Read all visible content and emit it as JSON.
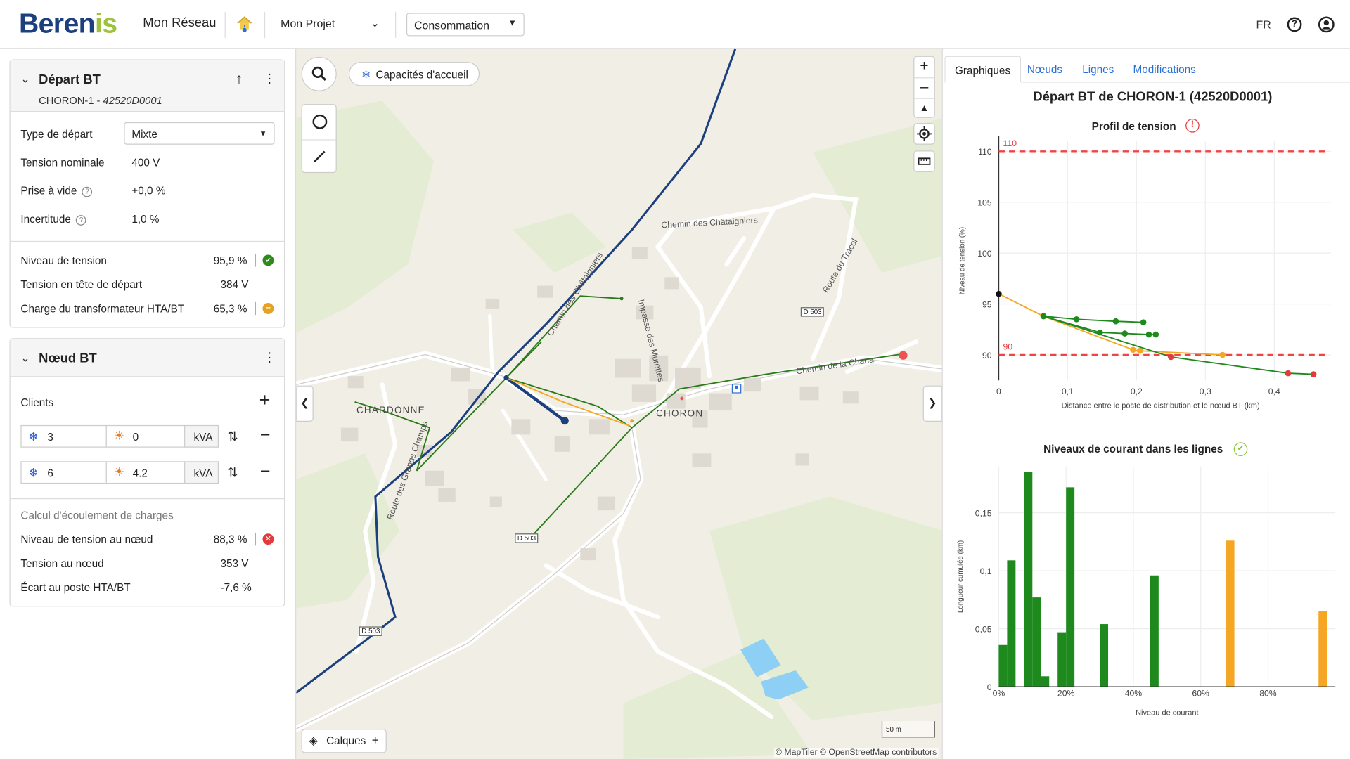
{
  "header": {
    "logo_main": "Beren",
    "logo_accent": "is",
    "app_title": "Mon Réseau",
    "project": "Mon Projet",
    "mode": "Consommation",
    "lang": "FR"
  },
  "depart": {
    "title": "Départ BT",
    "subtitle_name": "CHORON-1 - ",
    "subtitle_code": "42520D0001",
    "fields": [
      {
        "label": "Type de départ",
        "value": "Mixte"
      },
      {
        "label": "Tension nominale",
        "value": "400 V"
      },
      {
        "label": "Prise à vide",
        "value": "+0,0 %"
      },
      {
        "label": "Incertitude",
        "value": "1,0 %"
      }
    ],
    "results": [
      {
        "label": "Niveau de tension",
        "value": "95,9 %",
        "status": "ok"
      },
      {
        "label": "Tension en tête de départ",
        "value": "384 V"
      },
      {
        "label": "Charge du transformateur HTA/BT",
        "value": "65,3 %",
        "status": "warning"
      }
    ]
  },
  "noeud": {
    "title": "Nœud BT",
    "clients_label": "Clients",
    "clients": [
      {
        "cold": "3",
        "sun": "0",
        "unit": "kVA"
      },
      {
        "cold": "6",
        "sun": "4.2",
        "unit": "kVA"
      }
    ],
    "calc_label": "Calcul d'écoulement de charges",
    "results": [
      {
        "label": "Niveau de tension au nœud",
        "value": "88,3 %",
        "status": "error"
      },
      {
        "label": "Tension au nœud",
        "value": "353 V"
      },
      {
        "label": "Écart au poste HTA/BT",
        "value": "-7,6 %"
      }
    ]
  },
  "map": {
    "capacites": "Capacités d'accueil",
    "calques": "Calques",
    "attribution": "© MapTiler © OpenStreetMap contributors",
    "scale": "50 m",
    "labels": [
      "Chemin des Châtaigniers",
      "Impasse des Murettes",
      "Route du Tracol",
      "Chemin de la Chana",
      "Chemin des Châtaigniers",
      "Route des Grands Champs"
    ],
    "places": [
      "CHARDONNE",
      "CHORON"
    ],
    "roads": [
      "D 503",
      "D 503",
      "D 503"
    ]
  },
  "right": {
    "tabs": [
      "Graphiques",
      "Nœuds",
      "Lignes",
      "Modifications"
    ],
    "active_tab": "Graphiques",
    "title": "Départ BT de CHORON-1 (42520D0001)"
  },
  "colors": {
    "accent": "#2a6fd6",
    "brand_blue": "#1c3f7e",
    "brand_green": "#9cc33a",
    "ok": "#2f8a1c",
    "warn": "#e6a323",
    "err": "#e23b3b"
  },
  "chart_data": [
    {
      "type": "line",
      "title": "Profil de tension",
      "xlabel": "Distance entre le poste de distribution et le nœud BT (km)",
      "ylabel": "Niveau de tension (%)",
      "xlim": [
        0,
        0.47
      ],
      "ylim": [
        87.5,
        111
      ],
      "xticks": [
        "0",
        "0,1",
        "0,2",
        "0,3",
        "0,4"
      ],
      "yticks": [
        "90",
        "95",
        "100",
        "105",
        "110"
      ],
      "limits": [
        {
          "value": 110,
          "label": "110"
        },
        {
          "value": 90,
          "label": "90"
        }
      ],
      "series": [
        {
          "color": "#f5a623",
          "points": [
            [
              0,
              96
            ],
            [
              0.065,
              93.8
            ],
            [
              0.195,
              90.5
            ],
            [
              0.205,
              90.4
            ],
            [
              0.325,
              90
            ]
          ]
        },
        {
          "color": "#1e8a1e",
          "points": [
            [
              0.065,
              93.8
            ],
            [
              0.113,
              93.5
            ],
            [
              0.17,
              93.3
            ],
            [
              0.21,
              93.2
            ]
          ]
        },
        {
          "color": "#1e8a1e",
          "points": [
            [
              0.065,
              93.8
            ],
            [
              0.147,
              92.2
            ],
            [
              0.183,
              92.1
            ],
            [
              0.218,
              92
            ],
            [
              0.228,
              92
            ]
          ]
        },
        {
          "color": "#1e8a1e",
          "points": [
            [
              0.065,
              93.8
            ],
            [
              0.25,
              89.8
            ],
            [
              0.42,
              88.2
            ],
            [
              0.457,
              88.1
            ]
          ]
        }
      ],
      "status": "error"
    },
    {
      "type": "bar",
      "title": "Niveaux de courant dans les lignes",
      "xlabel": "Niveau de courant",
      "ylabel": "Longueur cumulée (km)",
      "xlim": [
        0,
        1
      ],
      "ylim": [
        0,
        0.19
      ],
      "xticks": [
        "0%",
        "20%",
        "40%",
        "60%",
        "80%"
      ],
      "yticks": [
        "0",
        "0,05",
        "0,1",
        "0,15"
      ],
      "bars": [
        {
          "x": 0.025,
          "v": 0.036,
          "c": "#1e8a1e"
        },
        {
          "x": 0.05,
          "v": 0.109,
          "c": "#1e8a1e"
        },
        {
          "x": 0.1,
          "v": 0.185,
          "c": "#1e8a1e"
        },
        {
          "x": 0.125,
          "v": 0.077,
          "c": "#1e8a1e"
        },
        {
          "x": 0.15,
          "v": 0.009,
          "c": "#1e8a1e"
        },
        {
          "x": 0.2,
          "v": 0.047,
          "c": "#1e8a1e"
        },
        {
          "x": 0.225,
          "v": 0.172,
          "c": "#1e8a1e"
        },
        {
          "x": 0.325,
          "v": 0.054,
          "c": "#1e8a1e"
        },
        {
          "x": 0.475,
          "v": 0.096,
          "c": "#1e8a1e"
        },
        {
          "x": 0.7,
          "v": 0.126,
          "c": "#f5a623"
        },
        {
          "x": 0.975,
          "v": 0.065,
          "c": "#f5a623"
        }
      ],
      "status": "ok"
    }
  ]
}
